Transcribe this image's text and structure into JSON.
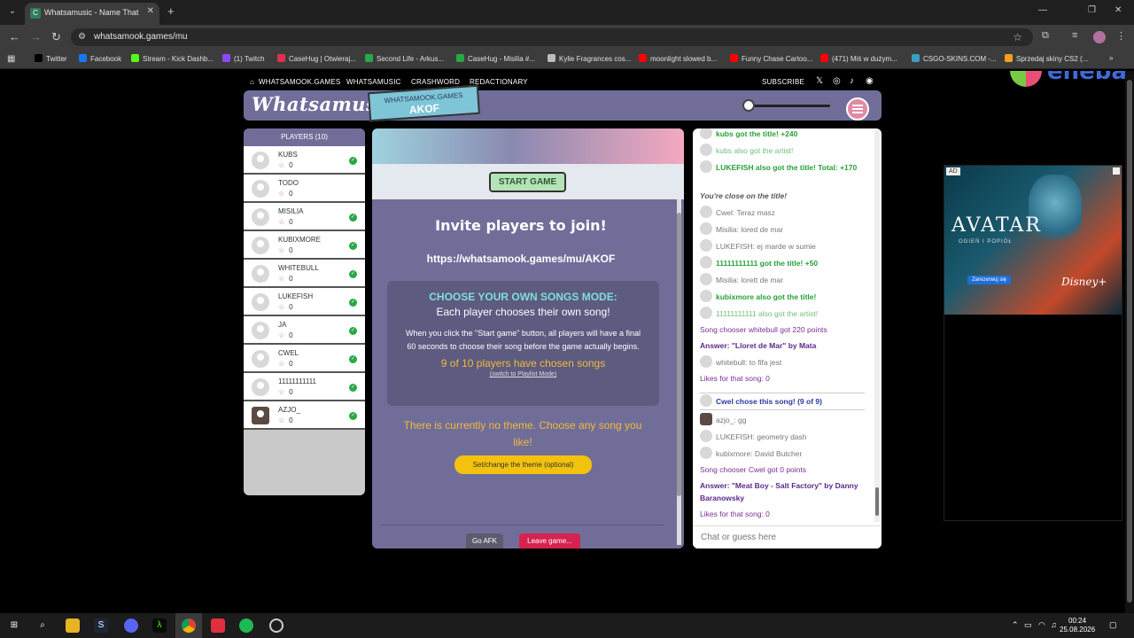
{
  "browser": {
    "tab_title": "Whatsamusic - Name That Tune",
    "url": "whatsamook.games/mu",
    "bookmarks": [
      {
        "label": "Twitter",
        "color": "#000000"
      },
      {
        "label": "Facebook",
        "color": "#1877f2"
      },
      {
        "label": "Stream - Kick Dashb...",
        "color": "#53fc18"
      },
      {
        "label": "(1) Twitch",
        "color": "#9146ff"
      },
      {
        "label": "CaseHug | Otwieraj...",
        "color": "#e0304e"
      },
      {
        "label": "Second Life - Arkus...",
        "color": "#2aa845"
      },
      {
        "label": "CaseHug - Misilia #...",
        "color": "#2aa845"
      },
      {
        "label": "Kylie Fragrances cos...",
        "color": "#bbbbbb"
      },
      {
        "label": "moonlight slowed b...",
        "color": "#ff0000"
      },
      {
        "label": "Funny Chase Cartoo...",
        "color": "#ff0000"
      },
      {
        "label": "(471) Miś w dużym...",
        "color": "#ff0000"
      },
      {
        "label": "CSGO-SKINS.COM -...",
        "color": "#3aa0c0"
      },
      {
        "label": "Sprzedaj skiny CS2 (...",
        "color": "#f4a020"
      }
    ]
  },
  "site": {
    "nav": [
      "WHATSAMOOK.GAMES",
      "WHATSAMUSIC",
      "CRASHWORD",
      "REDACTIONARY",
      "SUBSCRIBE"
    ],
    "logo": "Whatsamusic",
    "room_site": "WHATSAMOOK.GAMES",
    "room_code": "AKOF"
  },
  "players": {
    "header": "PLAYERS (10)",
    "list": [
      {
        "name": "KUBS",
        "score": "0",
        "ready": true,
        "custom_avatar": false
      },
      {
        "name": "TODO",
        "score": "0",
        "ready": false,
        "custom_avatar": false
      },
      {
        "name": "MISILIA",
        "score": "0",
        "ready": true,
        "custom_avatar": false
      },
      {
        "name": "KUBIXMORE",
        "score": "0",
        "ready": true,
        "custom_avatar": false
      },
      {
        "name": "WHITEBULL",
        "score": "0",
        "ready": true,
        "custom_avatar": false
      },
      {
        "name": "LUKEFISH",
        "score": "0",
        "ready": true,
        "custom_avatar": false
      },
      {
        "name": "JA",
        "score": "0",
        "ready": true,
        "custom_avatar": false
      },
      {
        "name": "CWEL",
        "score": "0",
        "ready": true,
        "custom_avatar": false
      },
      {
        "name": "11111111111",
        "score": "0",
        "ready": true,
        "custom_avatar": false
      },
      {
        "name": "AZJO_",
        "score": "0",
        "ready": true,
        "custom_avatar": true
      }
    ]
  },
  "game": {
    "start_label": "START GAME",
    "invite_title": "Invite players to join!",
    "invite_url": "https://whatsamook.games/mu/AKOF",
    "mode_title": "CHOOSE YOUR OWN SONGS MODE:",
    "mode_subtitle": "Each player chooses their own song!",
    "mode_desc": "When you click the \"Start game\" button, all players will have a final 60 seconds to choose their song before the game actually begins.",
    "mode_count": "9 of 10 players have chosen songs",
    "mode_switch": "(switch to Playlist Mode)",
    "theme_text": "There is currently no theme. Choose any song you like!",
    "theme_button": "Set/change the theme (optional)",
    "afk_label": "Go AFK",
    "leave_label": "Leave game..."
  },
  "chat": {
    "messages": [
      {
        "text": "kubs got the title! +240",
        "style": "green",
        "avatar": true
      },
      {
        "text": "kubs also got the artist!",
        "style": "greenlight",
        "avatar": true
      },
      {
        "text": "LUKEFISH also got the title! Total: +170",
        "style": "green",
        "avatar": true
      },
      {
        "text": "You're close on the title!",
        "style": "italic",
        "avatar": false
      },
      {
        "text": "Cwel: Teraz masz",
        "style": "normal",
        "avatar": true
      },
      {
        "text": "Misilia: lored de mar",
        "style": "normal",
        "avatar": true
      },
      {
        "text": "LUKEFISH: ej marde w sumie",
        "style": "normal",
        "avatar": true
      },
      {
        "text": "11111111111 got the title! +50",
        "style": "green",
        "avatar": true
      },
      {
        "text": "Misilia: lorett de mar",
        "style": "normal",
        "avatar": true
      },
      {
        "text": "kubixmore also got the title!",
        "style": "green",
        "avatar": true
      },
      {
        "text": "11111111111 also got the artist!",
        "style": "greenlight",
        "avatar": true
      },
      {
        "text": "Song chooser whitebull got 220 points",
        "style": "purple",
        "avatar": false
      },
      {
        "text": "Answer: \"Lloret de Mar\" by Mata",
        "style": "purplebold",
        "avatar": false
      },
      {
        "text": "whitebull: to fifa jest",
        "style": "normal",
        "avatar": true
      },
      {
        "text": "Likes for that song: 0",
        "style": "purple",
        "avatar": false
      },
      {
        "text": "Cwel chose this song! (9 of 9)",
        "style": "blue",
        "avatar": true
      },
      {
        "text": "azjo_: gg",
        "style": "normal",
        "avatar": "custom"
      },
      {
        "text": "LUKEFISH: geometry dash",
        "style": "normal",
        "avatar": true
      },
      {
        "text": "kubixmore: David Butcher",
        "style": "normal",
        "avatar": true
      },
      {
        "text": "Song chooser Cwel got 0 points",
        "style": "purple",
        "avatar": false
      },
      {
        "text": "Answer: \"Meat Boy - Salt Factory\" by Danny Baranowsky",
        "style": "purplebold",
        "avatar": false
      },
      {
        "text": "Likes for that song: 0",
        "style": "purple",
        "avatar": false
      }
    ],
    "input_placeholder": "Chat or guess here"
  },
  "ad": {
    "tag": "AD",
    "title": "AVATAR",
    "subtitle": "OGIEŃ I POPIÓŁ",
    "button": "Zarezerwuj się",
    "brand": "Disney+"
  },
  "eneba": "eneba",
  "taskbar": {
    "time": "00:24",
    "date": "25.08.2026"
  },
  "colors": {
    "accent": "#706e99",
    "ready": "#2aa845",
    "leave": "#d6224e",
    "theme": "#f3c20e"
  }
}
